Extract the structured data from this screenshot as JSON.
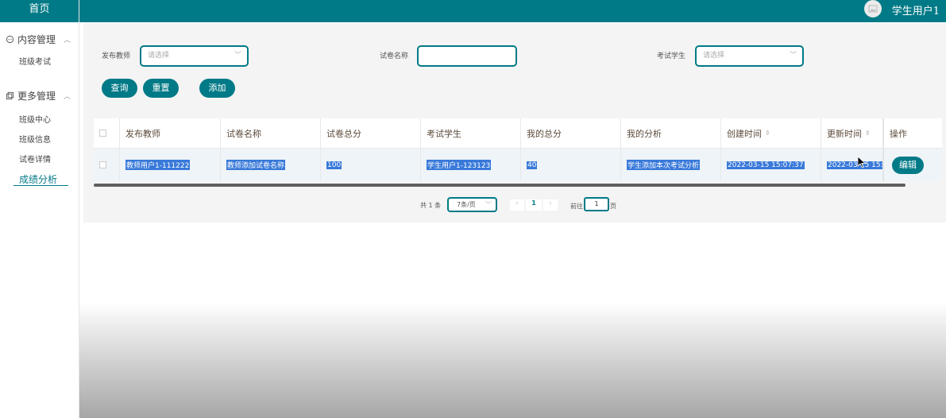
{
  "sidebar": {
    "home": "首页",
    "groups": [
      {
        "label": "内容管理",
        "items": [
          "班级考试"
        ]
      },
      {
        "label": "更多管理",
        "items": [
          "班级中心",
          "班级信息",
          "试卷详情",
          "成绩分析"
        ]
      }
    ],
    "active_item": "成绩分析"
  },
  "header": {
    "username": "学生用户1"
  },
  "filters": {
    "teacher_label": "发布教师",
    "teacher_placeholder": "请选择",
    "paper_label": "试卷名称",
    "paper_value": "",
    "student_label": "考试学生",
    "student_placeholder": "请选择"
  },
  "actions": {
    "query": "查询",
    "reset": "重置",
    "add": "添加"
  },
  "table": {
    "columns": [
      "发布教师",
      "试卷名称",
      "试卷总分",
      "考试学生",
      "我的总分",
      "我的分析",
      "创建时间",
      "更新时间",
      "操作"
    ],
    "rows": [
      {
        "teacher": "教师用户1-111222",
        "paper": "教师添加试卷名称",
        "total": "100",
        "student": "学生用户1-123123",
        "my_score": "40",
        "analysis": "学生添加本次考试分析",
        "created": "2022-03-15 15:07:37",
        "updated": "2022-03-15 15:",
        "action": "编辑"
      }
    ]
  },
  "pagination": {
    "total_text": "共 1 条",
    "page_size": "7条/页",
    "current_page": "1",
    "goto_label": "前往",
    "goto_value": "1",
    "page_suffix": "页"
  },
  "colors": {
    "primary": "#007a87",
    "selection": "#3879d9"
  }
}
